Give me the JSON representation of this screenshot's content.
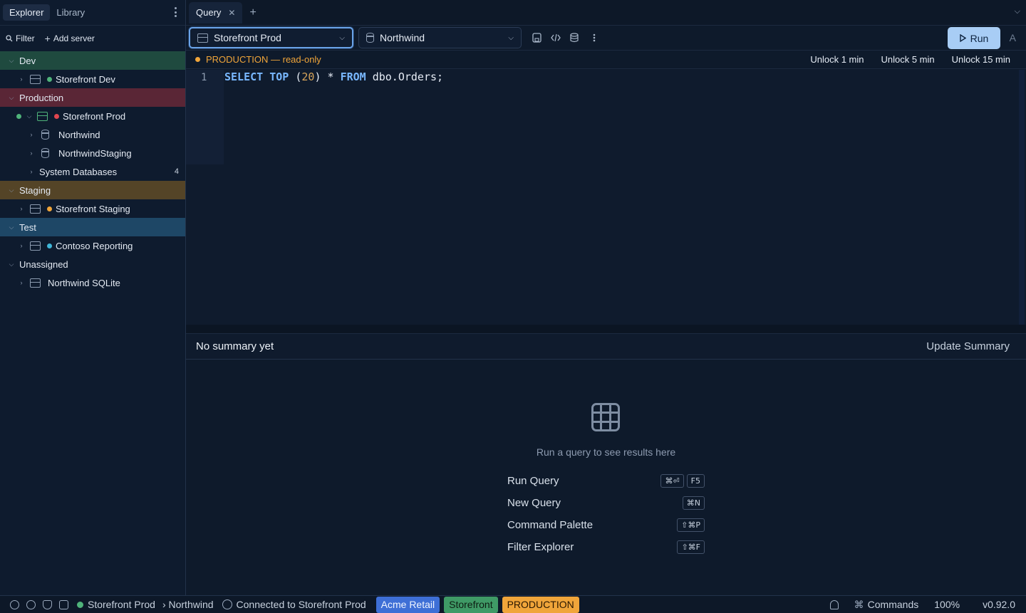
{
  "sidebar": {
    "tabs": [
      "Explorer",
      "Library"
    ],
    "filter_label": "Filter",
    "add_server_label": "Add server",
    "groups": {
      "dev": {
        "label": "Dev",
        "server": "Storefront Dev"
      },
      "prod": {
        "label": "Production",
        "server": "Storefront Prod",
        "databases": [
          "Northwind",
          "NorthwindStaging"
        ],
        "system_label": "System Databases",
        "system_count": "4"
      },
      "staging": {
        "label": "Staging",
        "server": "Storefront Staging"
      },
      "test": {
        "label": "Test",
        "server": "Contoso Reporting"
      },
      "unassigned": {
        "label": "Unassigned",
        "server": "Northwind SQLite"
      }
    }
  },
  "tabs": {
    "query": "Query"
  },
  "toolbar": {
    "server_select": "Storefront Prod",
    "db_select": "Northwind",
    "run_label": "Run",
    "after_run": "A"
  },
  "banner": {
    "text": "PRODUCTION — read-only",
    "unlock": [
      "Unlock 1 min",
      "Unlock 5 min",
      "Unlock 15 min"
    ]
  },
  "editor": {
    "line_number": "1",
    "tokens": {
      "select": "SELECT",
      "top": "TOP",
      "open": " (",
      "num": "20",
      "rest": ") * ",
      "from": "FROM",
      "table": " dbo.Orders;"
    }
  },
  "summary": {
    "text": "No summary yet",
    "update": "Update Summary"
  },
  "results": {
    "empty": "Run a query to see results here",
    "shortcuts": [
      {
        "label": "Run Query",
        "keys": [
          "⌘⏎",
          "F5"
        ]
      },
      {
        "label": "New Query",
        "keys": [
          "⌘N"
        ]
      },
      {
        "label": "Command Palette",
        "keys": [
          "⇧⌘P"
        ]
      },
      {
        "label": "Filter Explorer",
        "keys": [
          "⇧⌘F"
        ]
      }
    ]
  },
  "status": {
    "server": "Storefront Prod",
    "database": "› Northwind",
    "connected": "Connected to Storefront Prod",
    "tags": [
      "Acme Retail",
      "Storefront",
      "PRODUCTION"
    ],
    "commands": "Commands",
    "zoom": "100%",
    "version": "v0.92.0"
  },
  "colors": {
    "dev_dot": "#4fb37a",
    "prod_dot": "#e0464f",
    "staging_dot": "#f0a53a",
    "test_dot": "#3fb6d8",
    "accent": "#a8cdf5"
  }
}
